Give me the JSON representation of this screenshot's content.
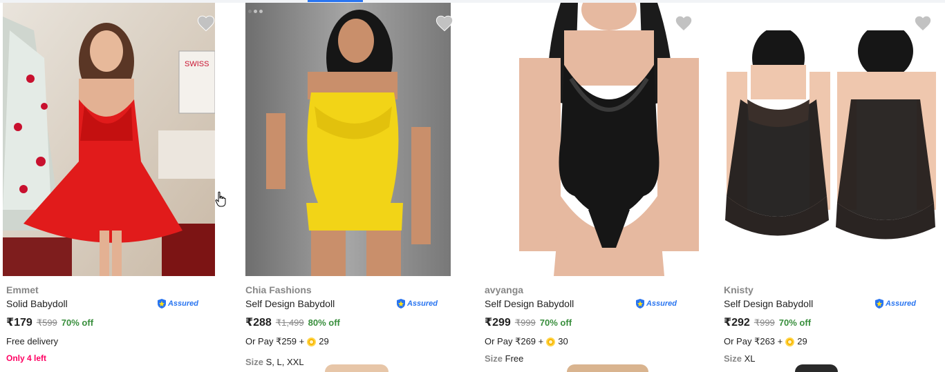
{
  "products": [
    {
      "brand": "Emmet",
      "title": "Solid Babydoll",
      "assured_label": "Assured",
      "price": "₹179",
      "mrp": "₹599",
      "discount": "70% off",
      "delivery": "Free delivery",
      "stock_note": "Only 4 left",
      "image_desc": "red-babydoll-christmas-photo"
    },
    {
      "brand": "Chia Fashions",
      "title": "Self Design Babydoll",
      "assured_label": "Assured",
      "price": "₹288",
      "mrp": "₹1,499",
      "discount": "80% off",
      "or_pay_prefix": "Or Pay ₹259 +",
      "coins": "29",
      "size_label": "Size",
      "size_value": "S, L, XXL",
      "image_desc": "yellow-lace-set-photo"
    },
    {
      "brand": "avyanga",
      "title": "Self Design Babydoll",
      "assured_label": "Assured",
      "price": "₹299",
      "mrp": "₹999",
      "discount": "70% off",
      "or_pay_prefix": "Or Pay ₹269 +",
      "coins": "30",
      "size_label": "Size",
      "size_value": "Free",
      "image_desc": "black-lace-bodysuit-photo"
    },
    {
      "brand": "Knisty",
      "title": "Self Design Babydoll",
      "assured_label": "Assured",
      "price": "₹292",
      "mrp": "₹999",
      "discount": "70% off",
      "or_pay_prefix": "Or Pay ₹263 +",
      "coins": "29",
      "size_label": "Size",
      "size_value": "XL",
      "image_desc": "black-sheer-babydoll-front-back-photo"
    }
  ],
  "icons": {
    "wishlist": "heart-icon",
    "assured": "assured-shield-icon",
    "coin": "supercoin-icon"
  },
  "colors": {
    "accent": "#2874f0",
    "discount": "#388e3c",
    "stock_warning": "#ff0062",
    "muted": "#878787"
  }
}
